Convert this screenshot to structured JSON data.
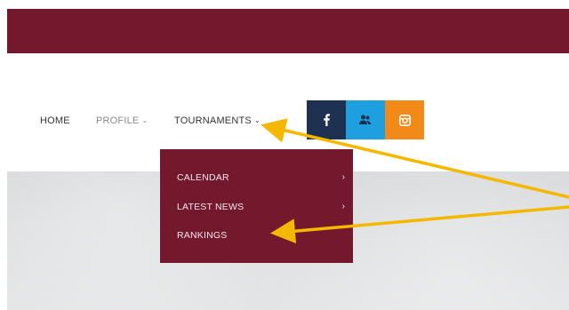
{
  "nav": {
    "home": "HOME",
    "profile": "PROFILE",
    "tournaments": "TOURNAMENTS",
    "chevron": "⌄"
  },
  "social": {
    "facebook_icon": "facebook-icon",
    "group_icon": "group-icon",
    "instagram_icon": "instagram-icon"
  },
  "dropdown": {
    "items": [
      {
        "label": "CALENDAR",
        "has_submenu": true
      },
      {
        "label": "LATEST NEWS",
        "has_submenu": true
      },
      {
        "label": "RANKINGS",
        "has_submenu": false
      }
    ],
    "submenu_chevron": "›"
  },
  "colors": {
    "brand": "#74192d",
    "facebook": "#1e3150",
    "group": "#1ea0e0",
    "instagram": "#f28a1a",
    "arrow": "#f5b800"
  }
}
